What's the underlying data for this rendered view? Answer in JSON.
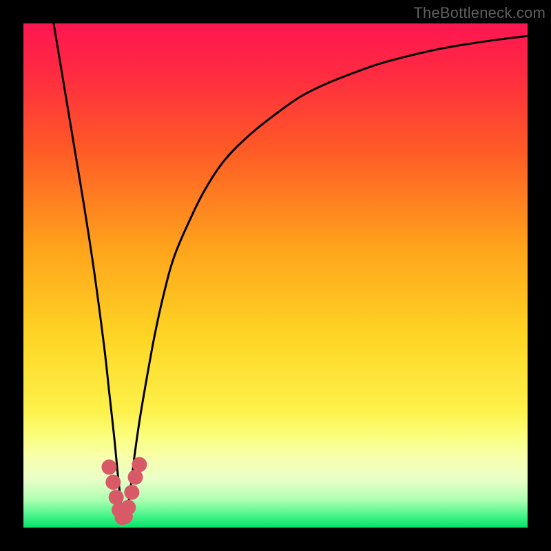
{
  "watermark": "TheBottleneck.com",
  "colors": {
    "frame": "#000000",
    "curve": "#000000",
    "markers": "#d85a67",
    "gradient_stops": [
      {
        "offset": 0.0,
        "color": "#ff1651"
      },
      {
        "offset": 0.1,
        "color": "#ff2b41"
      },
      {
        "offset": 0.25,
        "color": "#ff5a26"
      },
      {
        "offset": 0.45,
        "color": "#ffa51b"
      },
      {
        "offset": 0.62,
        "color": "#fed524"
      },
      {
        "offset": 0.77,
        "color": "#fdf24b"
      },
      {
        "offset": 0.82,
        "color": "#fbff80"
      },
      {
        "offset": 0.865,
        "color": "#f7ffb0"
      },
      {
        "offset": 0.905,
        "color": "#e9ffc8"
      },
      {
        "offset": 0.945,
        "color": "#aeffb2"
      },
      {
        "offset": 0.975,
        "color": "#4bf58a"
      },
      {
        "offset": 1.0,
        "color": "#05e26a"
      }
    ]
  },
  "chart_data": {
    "type": "line",
    "title": "",
    "xlabel": "",
    "ylabel": "",
    "xlim": [
      0,
      100
    ],
    "ylim": [
      0,
      100
    ],
    "x_min_point": 20,
    "series": [
      {
        "name": "bottleneck-curve",
        "x": [
          6,
          8,
          10,
          12,
          14,
          16,
          17,
          18,
          19,
          20,
          21,
          22,
          23,
          24,
          26,
          28,
          30,
          33,
          36,
          40,
          45,
          50,
          55,
          60,
          65,
          70,
          75,
          80,
          85,
          90,
          95,
          100
        ],
        "y": [
          100,
          88,
          76,
          64,
          51,
          36,
          27,
          18,
          8,
          1,
          6,
          14,
          21,
          27,
          38,
          47,
          54,
          61,
          67,
          73,
          78,
          82,
          85.5,
          88,
          90,
          91.8,
          93.2,
          94.4,
          95.4,
          96.2,
          96.9,
          97.5
        ]
      }
    ],
    "markers": {
      "name": "highlight-cluster",
      "x": [
        17.0,
        17.8,
        18.4,
        19.0,
        19.6,
        20.2,
        20.8,
        21.5,
        22.2,
        23.0
      ],
      "y": [
        12.0,
        9.0,
        6.0,
        3.5,
        2.0,
        2.2,
        4.0,
        7.0,
        10.0,
        12.5
      ]
    }
  }
}
